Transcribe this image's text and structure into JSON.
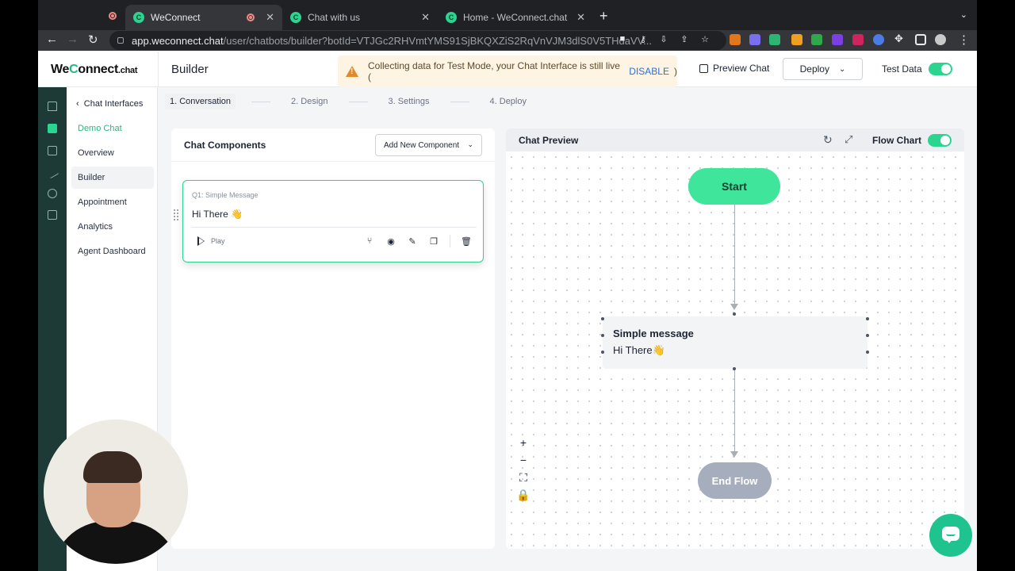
{
  "browser": {
    "tabs": [
      {
        "title": "WeConnect",
        "active": true
      },
      {
        "title": "Chat with us",
        "active": false
      },
      {
        "title": "Home - WeConnect.chat",
        "active": false
      }
    ],
    "url_host": "app.weconnect.chat",
    "url_path": "/user/chatbots/builder?botId=VTJGc2RHVmtYMS91SjBKQXZiS2RqVnVJM3dlS0V5THdaVV..."
  },
  "header": {
    "logo_we": "We",
    "logo_c": "C",
    "logo_onnect": "onnect",
    "logo_suffix": ".chat",
    "title": "Builder",
    "banner_text": "Collecting data for Test Mode, your Chat Interface is still live (",
    "banner_link": "DISABLE",
    "banner_close": ")",
    "preview_chat": "Preview Chat",
    "deploy": "Deploy",
    "test_data": "Test Data",
    "test_data_on": true
  },
  "sidenav": {
    "back": "Chat Interfaces",
    "items": [
      {
        "label": "Demo Chat"
      },
      {
        "label": "Overview"
      },
      {
        "label": "Builder"
      },
      {
        "label": "Appointment"
      },
      {
        "label": "Analytics"
      },
      {
        "label": "Agent Dashboard"
      }
    ]
  },
  "steps": [
    "1. Conversation",
    "2. Design",
    "3. Settings",
    "4. Deploy"
  ],
  "components": {
    "title": "Chat Components",
    "add_button": "Add New Component",
    "card": {
      "label": "Q1: Simple Message",
      "message": "Hi There 👋",
      "play": "Play"
    }
  },
  "preview": {
    "title": "Chat Preview",
    "flow_chart": "Flow Chart",
    "flow_chart_on": true,
    "start": "Start",
    "node_title": "Simple message",
    "node_text": "Hi There👋",
    "end": "End Flow",
    "zoom_in": "+",
    "zoom_out": "−"
  },
  "colors": {
    "accent": "#2bd48f",
    "rail": "#1e3a37",
    "end_node": "#a6aebe"
  }
}
